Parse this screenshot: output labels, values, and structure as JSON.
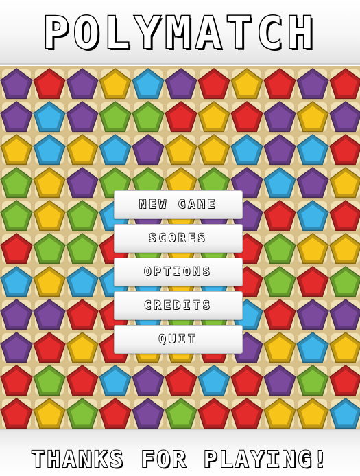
{
  "title": "POLYMATCH",
  "footer": "THANKS FOR PLAYING!",
  "menu": {
    "new_game": "NEW GAME",
    "scores": "SCORES",
    "options": "OPTIONS",
    "credits": "CREDITS",
    "quit": "QUIT"
  },
  "colors": {
    "purple": "#7b4a9c",
    "red": "#e42b2b",
    "yellow": "#f7c41a",
    "blue": "#3fb4e8",
    "green": "#82c23a",
    "board": "#d8c08a"
  },
  "board": {
    "cell_icon": "pentagon-gem",
    "rows": [
      [
        "purple",
        "red",
        "purple",
        "yellow",
        "blue",
        "purple",
        "red",
        "yellow",
        "red",
        "purple",
        "red"
      ],
      [
        "purple",
        "blue",
        "purple",
        "green",
        "green",
        "red",
        "yellow",
        "red",
        "purple",
        "yellow",
        "purple"
      ],
      [
        "yellow",
        "blue",
        "yellow",
        "blue",
        "purple",
        "yellow",
        "yellow",
        "blue",
        "purple",
        "blue",
        "red"
      ],
      [
        "green",
        "yellow",
        "purple",
        "green",
        "green",
        "yellow",
        "green",
        "purple",
        "blue",
        "purple",
        "yellow"
      ],
      [
        "green",
        "yellow",
        "green",
        "blue",
        "purple",
        "yellow",
        "purple",
        "purple",
        "red",
        "blue",
        "red"
      ],
      [
        "red",
        "green",
        "green",
        "red",
        "green",
        "yellow",
        "green",
        "red",
        "green",
        "yellow",
        "yellow"
      ],
      [
        "blue",
        "yellow",
        "blue",
        "blue",
        "blue",
        "yellow",
        "blue",
        "red",
        "green",
        "red",
        "green"
      ],
      [
        "purple",
        "purple",
        "red",
        "red",
        "blue",
        "green",
        "green",
        "blue",
        "red",
        "purple",
        "purple"
      ],
      [
        "purple",
        "red",
        "yellow",
        "red",
        "yellow",
        "yellow",
        "red",
        "purple",
        "yellow",
        "blue",
        "yellow"
      ],
      [
        "red",
        "green",
        "red",
        "blue",
        "purple",
        "red",
        "blue",
        "red",
        "purple",
        "green",
        "red"
      ],
      [
        "red",
        "yellow",
        "green",
        "red",
        "purple",
        "green",
        "red",
        "red",
        "yellow",
        "yellow",
        "blue"
      ]
    ]
  }
}
